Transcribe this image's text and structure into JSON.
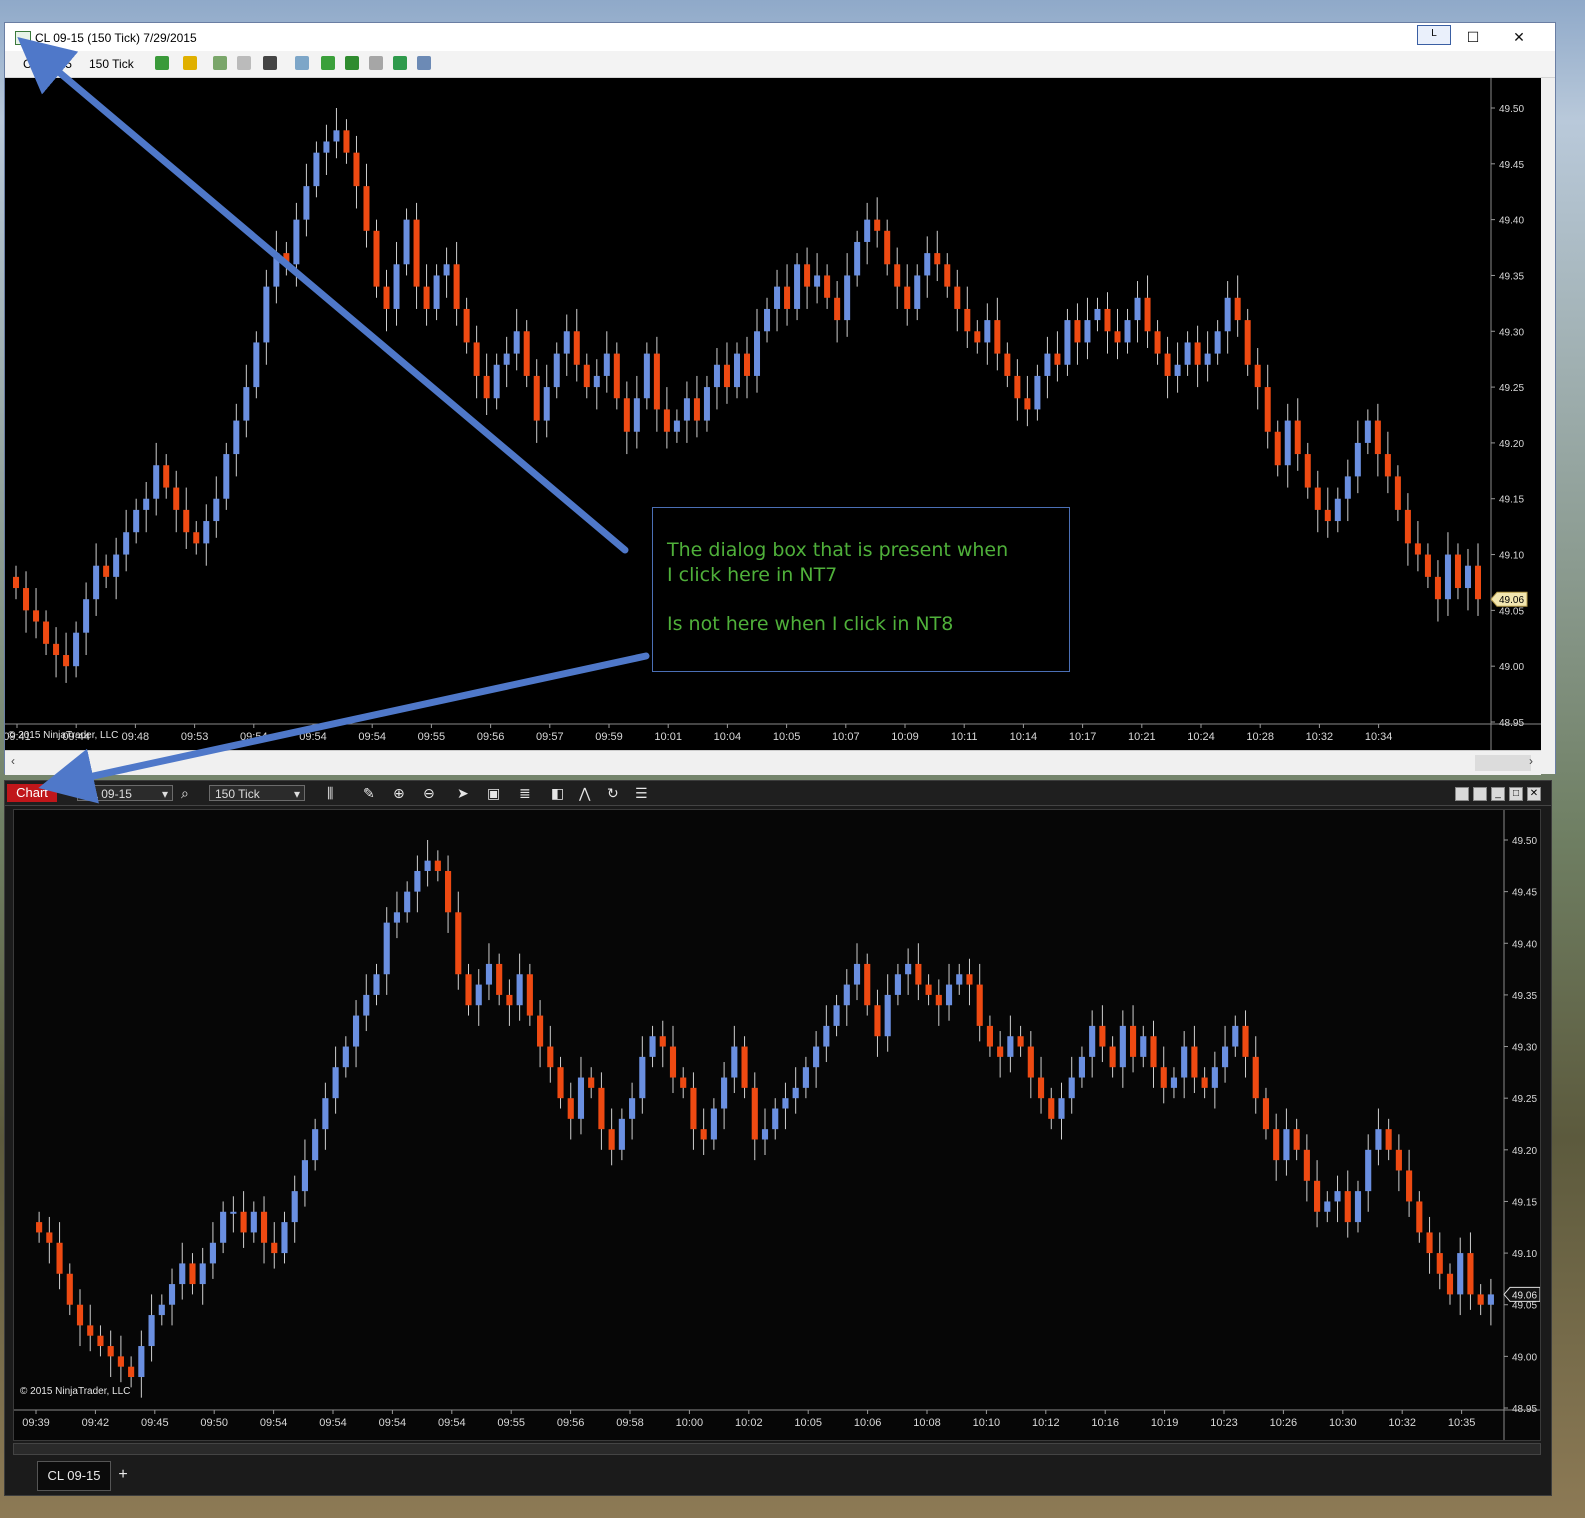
{
  "nt7": {
    "title": "CL 09-15 (150 Tick)  7/29/2015",
    "toolbar": {
      "instrument": "CL 09-15",
      "interval": "150 Tick"
    },
    "window_buttons": {
      "minimize": "L"
    },
    "copyright": "© 2015 NinjaTrader, LLC",
    "price_tag": "49.06"
  },
  "nt8": {
    "chart_button": "Chart",
    "instrument_select": "CL 09-15",
    "interval_select": "150 Tick",
    "copyright": "© 2015 NinjaTrader, LLC",
    "price_tag": "49.06",
    "tab_label": "CL 09-15",
    "add_tab": "+"
  },
  "annotation": {
    "line1": "The dialog box  that is present when",
    "line2": "I click here in NT7",
    "line3": "Is not here when I click in NT8"
  },
  "colors": {
    "up": "#6a8fe0",
    "down": "#ee4a12",
    "bg": "#000000"
  },
  "chart_data": [
    {
      "type": "candlestick",
      "ylim": [
        48.95,
        49.5
      ],
      "y_ticks": [
        "49.50",
        "49.45",
        "49.40",
        "49.35",
        "49.30",
        "49.25",
        "49.20",
        "49.15",
        "49.10",
        "49.05",
        "49.00",
        "48.95"
      ],
      "x_ticks": [
        "09:41",
        "09:44",
        "09:48",
        "09:53",
        "09:54",
        "09:54",
        "09:54",
        "09:55",
        "09:56",
        "09:57",
        "09:59",
        "10:01",
        "10:04",
        "10:05",
        "10:07",
        "10:09",
        "10:11",
        "10:14",
        "10:17",
        "10:21",
        "10:24",
        "10:28",
        "10:32",
        "10:34"
      ],
      "last_price": 49.06,
      "closes": [
        49.07,
        49.05,
        49.04,
        49.02,
        49.01,
        49.0,
        49.03,
        49.06,
        49.09,
        49.08,
        49.1,
        49.12,
        49.14,
        49.15,
        49.18,
        49.16,
        49.14,
        49.12,
        49.11,
        49.13,
        49.15,
        49.19,
        49.22,
        49.25,
        49.29,
        49.34,
        49.37,
        49.36,
        49.4,
        49.43,
        49.46,
        49.47,
        49.48,
        49.46,
        49.43,
        49.39,
        49.34,
        49.32,
        49.36,
        49.4,
        49.34,
        49.32,
        49.35,
        49.36,
        49.32,
        49.29,
        49.26,
        49.24,
        49.27,
        49.28,
        49.3,
        49.26,
        49.22,
        49.25,
        49.28,
        49.3,
        49.27,
        49.25,
        49.26,
        49.28,
        49.24,
        49.21,
        49.24,
        49.28,
        49.23,
        49.21,
        49.22,
        49.24,
        49.22,
        49.25,
        49.27,
        49.25,
        49.28,
        49.26,
        49.3,
        49.32,
        49.34,
        49.32,
        49.36,
        49.34,
        49.35,
        49.33,
        49.31,
        49.35,
        49.38,
        49.4,
        49.39,
        49.36,
        49.34,
        49.32,
        49.35,
        49.37,
        49.36,
        49.34,
        49.32,
        49.3,
        49.29,
        49.31,
        49.28,
        49.26,
        49.24,
        49.23,
        49.26,
        49.28,
        49.27,
        49.31,
        49.29,
        49.31,
        49.32,
        49.3,
        49.29,
        49.31,
        49.33,
        49.3,
        49.28,
        49.26,
        49.27,
        49.29,
        49.27,
        49.28,
        49.3,
        49.33,
        49.31,
        49.27,
        49.25,
        49.21,
        49.18,
        49.22,
        49.19,
        49.16,
        49.14,
        49.13,
        49.15,
        49.17,
        49.2,
        49.22,
        49.19,
        49.17,
        49.14,
        49.11,
        49.1,
        49.08,
        49.06,
        49.1,
        49.07,
        49.09,
        49.06
      ],
      "volumes": []
    },
    {
      "type": "candlestick",
      "ylim": [
        48.95,
        49.5
      ],
      "y_ticks": [
        "49.50",
        "49.45",
        "49.40",
        "49.35",
        "49.30",
        "49.25",
        "49.20",
        "49.15",
        "49.10",
        "49.05",
        "49.00",
        "48.95"
      ],
      "x_ticks": [
        "09:39",
        "09:42",
        "09:45",
        "09:50",
        "09:54",
        "09:54",
        "09:54",
        "09:54",
        "09:55",
        "09:56",
        "09:58",
        "10:00",
        "10:02",
        "10:05",
        "10:06",
        "10:08",
        "10:10",
        "10:12",
        "10:16",
        "10:19",
        "10:23",
        "10:26",
        "10:30",
        "10:32",
        "10:35"
      ],
      "last_price": 49.06,
      "closes": [
        49.12,
        49.11,
        49.08,
        49.05,
        49.03,
        49.02,
        49.01,
        49.0,
        48.99,
        48.98,
        49.01,
        49.04,
        49.05,
        49.07,
        49.09,
        49.07,
        49.09,
        49.11,
        49.14,
        49.14,
        49.12,
        49.14,
        49.11,
        49.1,
        49.13,
        49.16,
        49.19,
        49.22,
        49.25,
        49.28,
        49.3,
        49.33,
        49.35,
        49.37,
        49.42,
        49.43,
        49.45,
        49.47,
        49.48,
        49.47,
        49.43,
        49.37,
        49.34,
        49.36,
        49.38,
        49.35,
        49.34,
        49.37,
        49.33,
        49.3,
        49.28,
        49.25,
        49.23,
        49.27,
        49.26,
        49.22,
        49.2,
        49.23,
        49.25,
        49.29,
        49.31,
        49.3,
        49.27,
        49.26,
        49.22,
        49.21,
        49.24,
        49.27,
        49.3,
        49.26,
        49.21,
        49.22,
        49.24,
        49.25,
        49.26,
        49.28,
        49.3,
        49.32,
        49.34,
        49.36,
        49.38,
        49.34,
        49.31,
        49.35,
        49.37,
        49.38,
        49.36,
        49.35,
        49.34,
        49.36,
        49.37,
        49.36,
        49.32,
        49.3,
        49.29,
        49.31,
        49.3,
        49.27,
        49.25,
        49.23,
        49.25,
        49.27,
        49.29,
        49.32,
        49.3,
        49.28,
        49.32,
        49.29,
        49.31,
        49.28,
        49.26,
        49.27,
        49.3,
        49.27,
        49.26,
        49.28,
        49.3,
        49.32,
        49.29,
        49.25,
        49.22,
        49.19,
        49.22,
        49.2,
        49.17,
        49.14,
        49.15,
        49.16,
        49.13,
        49.16,
        49.2,
        49.22,
        49.2,
        49.18,
        49.15,
        49.12,
        49.1,
        49.08,
        49.06,
        49.1,
        49.06,
        49.05,
        49.06
      ],
      "volumes": []
    }
  ]
}
